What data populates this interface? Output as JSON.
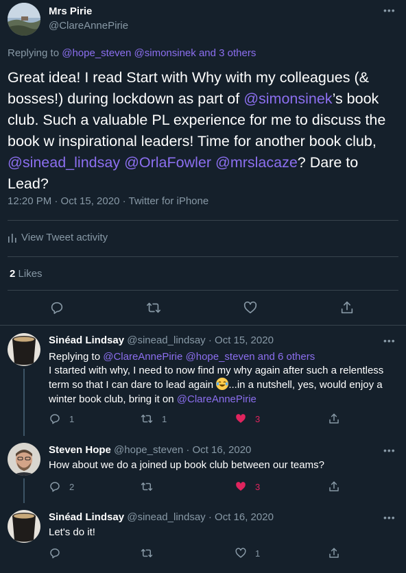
{
  "main": {
    "name": "Mrs Pirie",
    "handle": "@ClareAnnePirie",
    "replying_prefix": "Replying to ",
    "replying_to": "@hope_steven @simonsinek and 3 others",
    "text": {
      "p1": "Great idea! I read Start with Why with my colleagues (& bosses!) during lockdown as part of ",
      "mention1": "@simonsinek",
      "p2": "’s book club. Such a valuable PL experience for me to discuss the book w inspirational leaders! Time for another book club, ",
      "mention2": "@sinead_lindsay",
      "mention3": "@OrlaFowler",
      "mention4": "@mrslacaze",
      "p3": "? Dare to Lead?"
    },
    "meta": "12:20 PM · Oct 15, 2020 · Twitter for iPhone",
    "activity_label": "View Tweet activity",
    "likes_count": "2",
    "likes_label": "Likes"
  },
  "replies": [
    {
      "name": "Sinéad Lindsay",
      "handle": "@sinead_lindsay",
      "date": "· Oct 15, 2020",
      "replying_prefix": "Replying to ",
      "replying_to": "@ClareAnnePirie @hope_steven and 6 others",
      "text_a": "I started with why, I need to now find my why again after such a relentless term so that I can dare to lead again ",
      "text_b": "...in a nutshell, yes, would enjoy a winter book club, bring it on ",
      "mention": "@ClareAnnePirie",
      "reply_count": "1",
      "retweet_count": "1",
      "like_count": "3",
      "liked": true
    },
    {
      "name": "Steven Hope",
      "handle": "@hope_steven",
      "date": "· Oct 16, 2020",
      "text": "How about we do a joined up book club between our teams?",
      "reply_count": "2",
      "retweet_count": "",
      "like_count": "3",
      "liked": true
    },
    {
      "name": "Sinéad Lindsay",
      "handle": "@sinead_lindsay",
      "date": "· Oct 16, 2020",
      "text": "Let's do it!",
      "reply_count": "",
      "retweet_count": "",
      "like_count": "1",
      "liked": false
    }
  ],
  "icons": {
    "more": "more-icon",
    "reply": "reply-icon",
    "retweet": "retweet-icon",
    "like": "heart-icon",
    "share": "share-icon",
    "activity": "activity-icon",
    "emoji": "tears-of-joy-emoji"
  },
  "colors": {
    "background": "#15202b",
    "accent": "#8c6ff0",
    "muted": "#8899a6",
    "like": "#e0245e",
    "divider": "#38444d"
  }
}
